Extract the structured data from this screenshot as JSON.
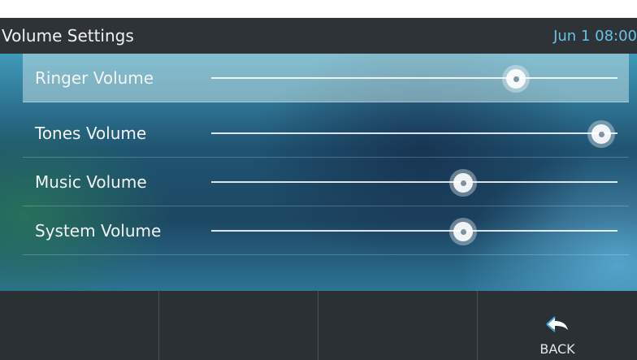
{
  "header": {
    "title": "Volume Settings",
    "datetime": "Jun 1 08:00"
  },
  "settings": [
    {
      "label": "Ringer Volume",
      "level": 0.75,
      "selected": true
    },
    {
      "label": "Tones Volume",
      "level": 0.96,
      "selected": false
    },
    {
      "label": "Music Volume",
      "level": 0.62,
      "selected": false
    },
    {
      "label": "System Volume",
      "level": 0.62,
      "selected": false
    }
  ],
  "softkeys": [
    {
      "label": "",
      "icon": ""
    },
    {
      "label": "",
      "icon": ""
    },
    {
      "label": "",
      "icon": ""
    },
    {
      "label": "BACK",
      "icon": "back-arrow-icon"
    }
  ],
  "colors": {
    "title_bar": "#2e3338",
    "clock": "#67c3e6",
    "softkey_bar": "#2b3035"
  }
}
